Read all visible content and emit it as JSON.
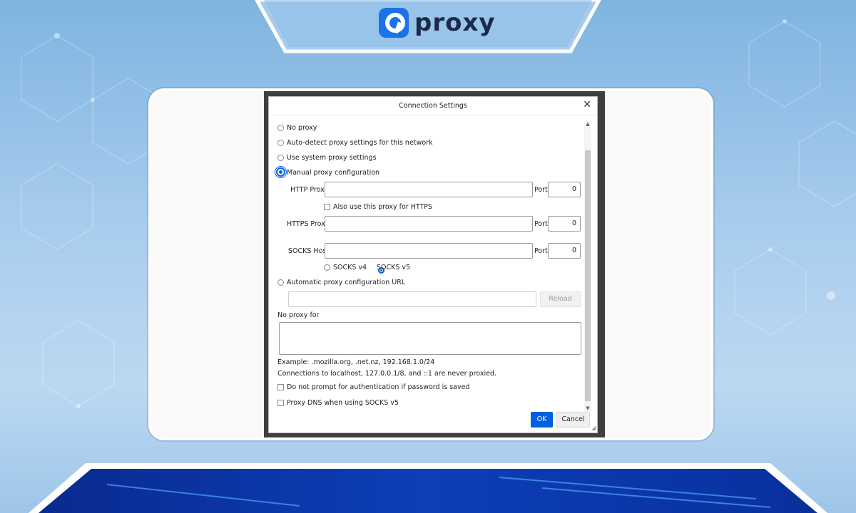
{
  "brand": {
    "name": "proxy",
    "accent": "#1a73e8"
  },
  "dialog": {
    "title": "Connection Settings",
    "close_symbol": "✕",
    "options": {
      "no_proxy": "No proxy",
      "auto_detect": "Auto-detect proxy settings for this network",
      "system": "Use system proxy settings",
      "manual": "Manual proxy configuration",
      "auto_url": "Automatic proxy configuration URL"
    },
    "selected_option": "manual",
    "http_proxy": {
      "label": "HTTP Proxy",
      "value": "",
      "port_label": "Port",
      "port_value": "0"
    },
    "also_https": "Also use this proxy for HTTPS",
    "https_proxy": {
      "label": "HTTPS Proxy",
      "value": "",
      "port_label": "Port",
      "port_value": "0"
    },
    "socks_host": {
      "label": "SOCKS Host",
      "value": "",
      "port_label": "Port",
      "port_value": "0"
    },
    "socks_v4": "SOCKS v4",
    "socks_v5": "SOCKS v5",
    "socks_selected": "v5",
    "reload_label": "Reload",
    "no_proxy_for_label": "No proxy for",
    "example_text": "Example: .mozilla.org, .net.nz, 192.168.1.0/24",
    "localhost_note": "Connections to localhost, 127.0.0.1/8, and ::1 are never proxied.",
    "no_prompt_auth": "Do not prompt for authentication if password is saved",
    "proxy_dns": "Proxy DNS when using SOCKS v5",
    "ok_label": "OK",
    "cancel_label": "Cancel"
  }
}
